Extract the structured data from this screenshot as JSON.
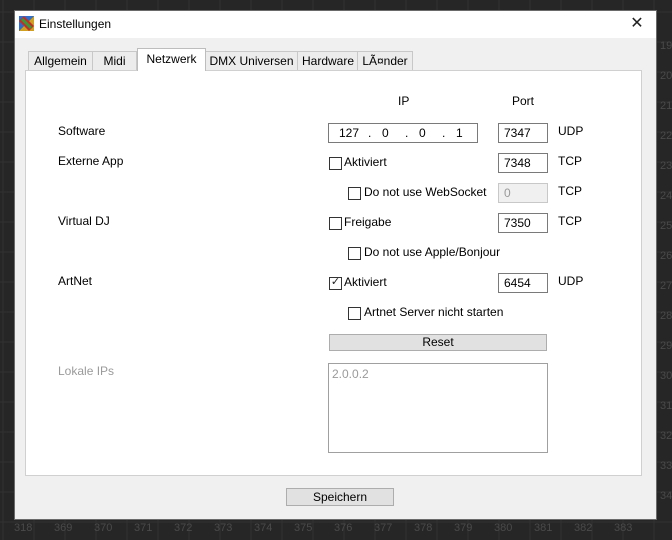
{
  "window": {
    "title": "Einstellungen",
    "close_glyph": "✕"
  },
  "tabs": [
    {
      "label": "Allgemein",
      "active": false
    },
    {
      "label": "Midi",
      "active": false
    },
    {
      "label": "Netzwerk",
      "active": true
    },
    {
      "label": "DMX Universen",
      "active": false
    },
    {
      "label": "Hardware",
      "active": false
    },
    {
      "label": "LÃ¤nder",
      "active": false
    }
  ],
  "network": {
    "col_ip": "IP",
    "col_port": "Port",
    "software": {
      "label": "Software",
      "ip": [
        "127",
        "0",
        "0",
        "1"
      ],
      "ip_sep": ".",
      "port": "7347",
      "protocol": "UDP"
    },
    "external_app": {
      "label": "Externe App",
      "checkbox_label": "Aktiviert",
      "checked": false,
      "port": "7348",
      "protocol": "TCP",
      "sub_checkbox_label": "Do not use WebSocket",
      "sub_checked": false,
      "sub_port": "0",
      "sub_protocol": "TCP"
    },
    "virtual_dj": {
      "label": "Virtual DJ",
      "checkbox_label": "Freigabe",
      "checked": false,
      "port": "7350",
      "protocol": "TCP",
      "sub_checkbox_label": "Do not use Apple/Bonjour",
      "sub_checked": false
    },
    "artnet": {
      "label": "ArtNet",
      "checkbox_label": "Aktiviert",
      "checked": true,
      "port": "6454",
      "protocol": "UDP",
      "sub_checkbox_label": "Artnet Server nicht starten",
      "sub_checked": false
    },
    "reset_label": "Reset",
    "local_ips": {
      "label": "Lokale IPs",
      "items": [
        "2.0.0.2"
      ]
    }
  },
  "footer": {
    "save_label": "Speichern"
  },
  "background": {
    "numbers": [
      "318",
      "369",
      "370",
      "371",
      "372",
      "373",
      "374",
      "375",
      "376",
      "377",
      "378",
      "379",
      "380",
      "381",
      "382",
      "383"
    ],
    "side_numbers": [
      "19",
      "20",
      "21",
      "22",
      "23",
      "24",
      "25",
      "26",
      "27",
      "28",
      "29",
      "30",
      "31",
      "32",
      "33",
      "34"
    ]
  }
}
